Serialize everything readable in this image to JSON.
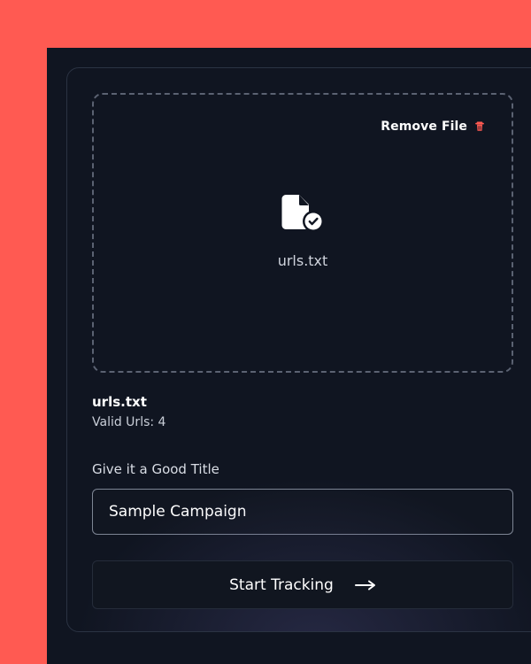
{
  "upload": {
    "remove_file_label": "Remove File",
    "file_name_center": "urls.txt",
    "file_name": "urls.txt",
    "valid_urls": "Valid Urls: 4"
  },
  "form": {
    "title_label": "Give it a Good Title",
    "title_value": "Sample Campaign",
    "start_button_label": "Start Tracking"
  },
  "icons": {
    "remove": "trash-icon",
    "file": "file-check-icon",
    "start": "arrow-right-icon"
  },
  "colors": {
    "outer_background": "#FF5A52",
    "panel_background": "#101521",
    "remove_icon": "#FF5A52",
    "text_primary": "#FFFFFF"
  }
}
